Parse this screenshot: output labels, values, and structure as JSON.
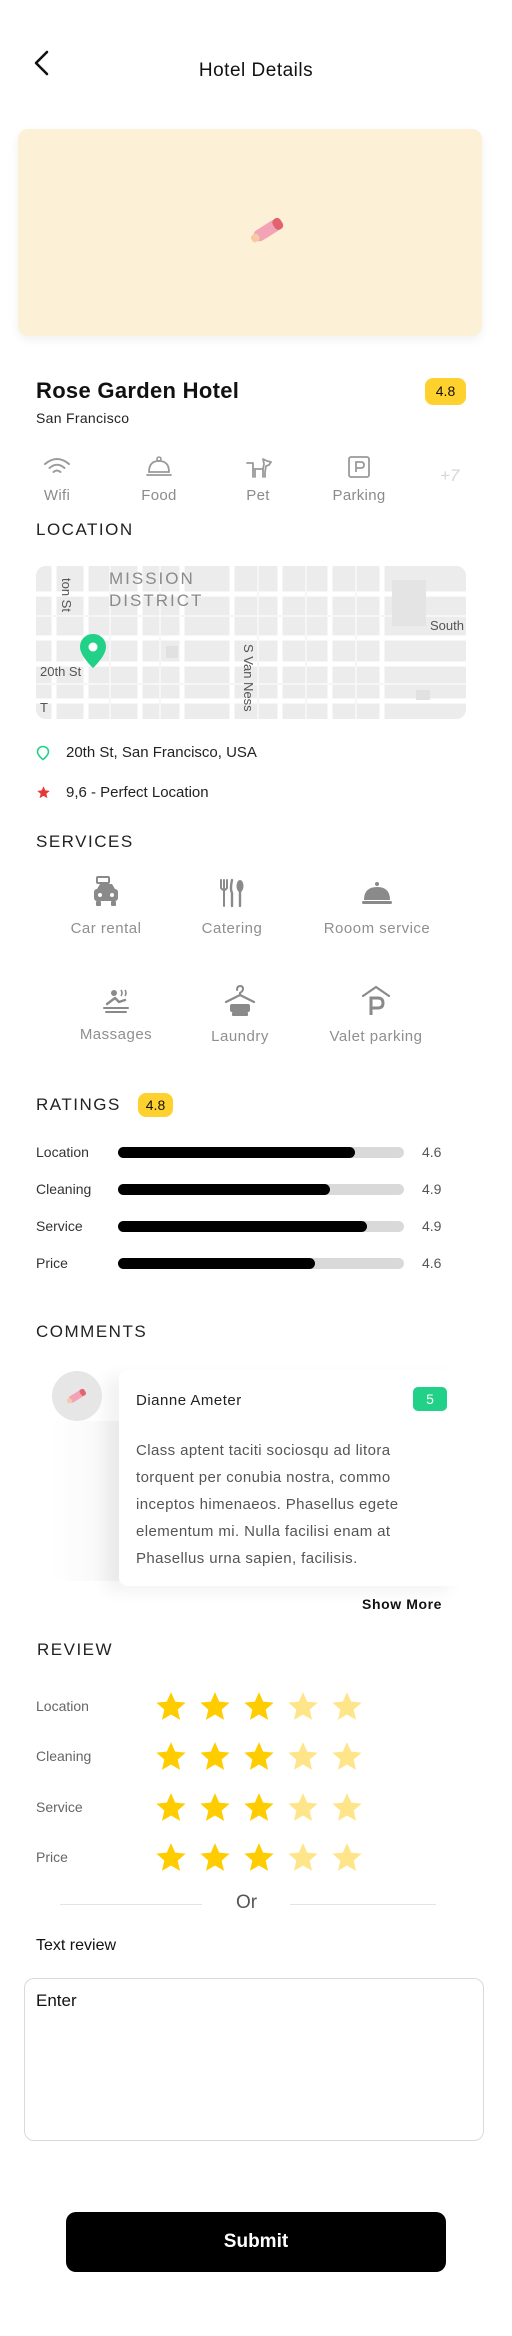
{
  "header": {
    "title": "Hotel Details"
  },
  "hotel": {
    "name": "Rose Garden Hotel",
    "city": "San Francisco",
    "rating": "4.8"
  },
  "amenities": {
    "items": [
      {
        "label": "Wifi",
        "icon": "wifi-icon"
      },
      {
        "label": "Food",
        "icon": "food-cloche-icon"
      },
      {
        "label": "Pet",
        "icon": "dog-icon"
      },
      {
        "label": "Parking",
        "icon": "parking-icon"
      }
    ],
    "more": "+7"
  },
  "location": {
    "title": "LOCATION",
    "map_labels": {
      "district_line1": "MISSION",
      "district_line2": "DISTRICT",
      "street_vertical": "ton St",
      "street_20th": "20th St",
      "street_van_ness": "S Van Ness",
      "street_south": "South",
      "street_t": "T"
    },
    "address": "20th St, San Francisco, USA",
    "score": "9,6 - Perfect Location",
    "colors": {
      "pin": "#21d187",
      "star": "#e53935"
    }
  },
  "services": {
    "title": "SERVICES",
    "items": [
      {
        "label": "Car rental",
        "icon": "car-rental-icon"
      },
      {
        "label": "Catering",
        "icon": "catering-icon"
      },
      {
        "label": "Rooom service",
        "icon": "room-service-bell-icon"
      },
      {
        "label": "Massages",
        "icon": "massage-icon"
      },
      {
        "label": "Laundry",
        "icon": "laundry-icon"
      },
      {
        "label": "Valet parking",
        "icon": "valet-parking-icon"
      }
    ]
  },
  "ratings": {
    "title": "RATINGS",
    "badge": "4.8",
    "items": [
      {
        "label": "Location",
        "value": "4.6",
        "fill": 0.83
      },
      {
        "label": "Cleaning",
        "value": "4.9",
        "fill": 0.74
      },
      {
        "label": "Service",
        "value": "4.9",
        "fill": 0.87
      },
      {
        "label": "Price",
        "value": "4.6",
        "fill": 0.69
      }
    ]
  },
  "comments": {
    "title": "COMMENTS",
    "items": [
      {
        "name": "Dianne Ameter",
        "score": "5",
        "text": "Class aptent taciti sociosqu ad litora torquent per conubia nostra, commo inceptos himenaeos. Phasellus egete elementum mi. Nulla facilisi enam at Phasellus urna sapien, facilisis."
      }
    ],
    "show_more": "Show More"
  },
  "review": {
    "title": "REVIEW",
    "items": [
      {
        "label": "Location",
        "stars": 3
      },
      {
        "label": "Cleaning",
        "stars": 3
      },
      {
        "label": "Service",
        "stars": 3
      },
      {
        "label": "Price",
        "stars": 3
      }
    ],
    "max_stars": 5,
    "colors": {
      "star_on": "#ffcc00",
      "star_off": "#ffe58a"
    },
    "or": "Or",
    "text_review_title": "Text review",
    "text_review_placeholder": "Enter"
  },
  "submit_label": "Submit"
}
